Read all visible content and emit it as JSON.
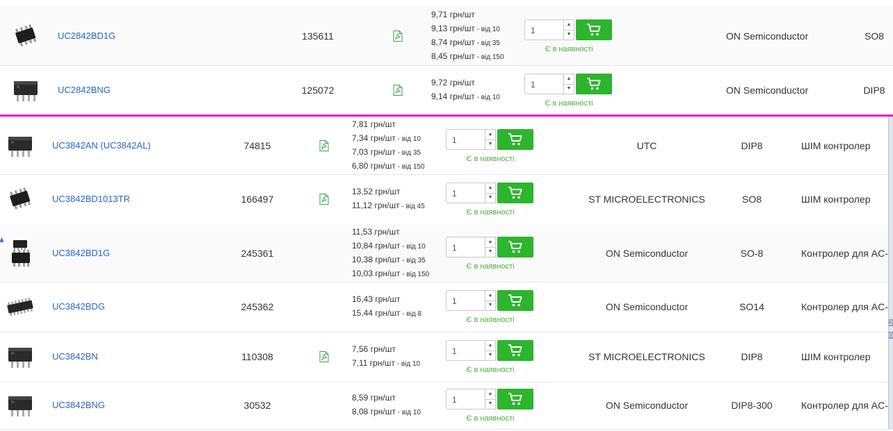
{
  "qty_default": "1",
  "in_stock": "Є в наявності",
  "top": [
    {
      "name": "UC2842BD1G",
      "code": "135611",
      "pdf": true,
      "prices": [
        {
          "p": "9,71 грн/шт",
          "q": ""
        },
        {
          "p": "9,13 грн/шт",
          "q": " - від 10"
        },
        {
          "p": "8,74 грн/шт",
          "q": " - від 35"
        },
        {
          "p": "8,45 грн/шт",
          "q": " - від 150"
        }
      ],
      "manufacturer": "ON Semiconductor",
      "package": "SO8",
      "thumb": "soic"
    },
    {
      "name": "UC2842BNG",
      "code": "125072",
      "pdf": true,
      "prices": [
        {
          "p": "9,72 грн/шт",
          "q": ""
        },
        {
          "p": "9,14 грн/шт",
          "q": " - від 10"
        }
      ],
      "manufacturer": "ON Semiconductor",
      "package": "DIP8",
      "thumb": "dip"
    }
  ],
  "bottom": [
    {
      "name": "UC3842AN (UC3842AL)",
      "code": "74815",
      "pdf": true,
      "prices": [
        {
          "p": "7,81 грн/шт",
          "q": ""
        },
        {
          "p": "7,34 грн/шт",
          "q": " - від 10"
        },
        {
          "p": "7,03 грн/шт",
          "q": " - від 35"
        },
        {
          "p": "6,80 грн/шт",
          "q": " - від 150"
        }
      ],
      "manufacturer": "UTC",
      "package": "DIP8",
      "description": "ШІМ контролер",
      "thumb": "dip"
    },
    {
      "name": "UC3842BD1013TR",
      "code": "166497",
      "pdf": true,
      "prices": [
        {
          "p": "13,52 грн/шт",
          "q": ""
        },
        {
          "p": "11,12 грн/шт",
          "q": " - від 45"
        }
      ],
      "manufacturer": "ST MICROELECTRONICS",
      "package": "SO8",
      "description": "ШІМ контролер",
      "thumb": "soic"
    },
    {
      "name": "UC3842BD1G",
      "code": "245361",
      "pdf": false,
      "prices": [
        {
          "p": "11,53 грн/шт",
          "q": ""
        },
        {
          "p": "10,84 грн/шт",
          "q": " - від 10"
        },
        {
          "p": "10,38 грн/шт",
          "q": " - від 35"
        },
        {
          "p": "10,03 грн/шт",
          "q": " - від 150"
        }
      ],
      "manufacturer": "ON Semiconductor",
      "package": "SO-8",
      "description": "Контролер для AC-",
      "thumb": "soic2"
    },
    {
      "name": "UC3842BDG",
      "code": "245362",
      "pdf": false,
      "prices": [
        {
          "p": "16,43 грн/шт",
          "q": ""
        },
        {
          "p": "15,44 грн/шт",
          "q": " - від 8"
        }
      ],
      "manufacturer": "ON Semiconductor",
      "package": "SO14",
      "description": "Контролер для AC-",
      "thumb": "so14"
    },
    {
      "name": "UC3842BN",
      "code": "110308",
      "pdf": true,
      "prices": [
        {
          "p": "7,56 грн/шт",
          "q": ""
        },
        {
          "p": "7,11 грн/шт",
          "q": " - від 10"
        }
      ],
      "manufacturer": "ST MICROELECTRONICS",
      "package": "DIP8",
      "description": "ШІМ контролер",
      "thumb": "dip"
    },
    {
      "name": "UC3842BNG",
      "code": "30532",
      "pdf": false,
      "prices": [
        {
          "p": "8,59 грн/шт",
          "q": ""
        },
        {
          "p": "8,08 грн/шт",
          "q": " - від 10"
        }
      ],
      "manufacturer": "ON Semiconductor",
      "package": "DIP8-300",
      "description": "Контролер для AC-",
      "thumb": "dip"
    }
  ],
  "scroll_marks": [
    "2",
    "0"
  ],
  "colors": {
    "link": "#2468c6",
    "cart": "#2db52d",
    "stock": "#4caf3a",
    "separator": "#e600e6"
  }
}
